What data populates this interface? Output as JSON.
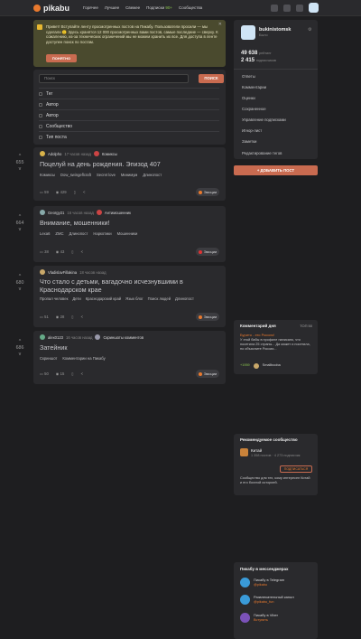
{
  "header": {
    "logo": "pikabu",
    "nav": [
      "Горячее",
      "Лучшее",
      "Свежее",
      "Подписки",
      "Сообщества"
    ],
    "subs_count": "90+"
  },
  "notice": {
    "text": "Привет! Вступайте ленту просмотренных постов на Пикабу. Пользователи просили — мы сделали 🙂 Здесь хранятся 12 000 просмотренных вами постов, самые последние — сверху. К сожалению, из-за технических ограничений мы не можем хранить их все. Для доступа в ленте доступен поиск по постам.",
    "button": "ПОНЯТНО"
  },
  "search": {
    "placeholder": "Поиск",
    "button": "ПОИСК",
    "filters": [
      "Тег",
      "Автор",
      "Автор",
      "Сообщество",
      "Тип поста"
    ]
  },
  "posts": [
    {
      "rating": "655",
      "author": "Adolpho",
      "time": "17 часов назад",
      "community": "Комиксы",
      "title": "Поцелуй на день рождения. Эпизод 407",
      "tags": [
        "Комиксы",
        "Dow_swingeflcraft",
        "Secret love",
        "Минимум",
        "Длинопост"
      ],
      "comments": "59",
      "views": "429",
      "emotion": "Эмоции"
    },
    {
      "rating": "664",
      "author": "Georgy21",
      "time": "16 часов назад",
      "community": "Антимошенник",
      "title": "Внимание, мошенники!",
      "tags": [
        "Lexa6",
        "ZMC",
        "Длинопост",
        "Наркотики",
        "Мошенники"
      ],
      "comments": "38",
      "views": "43",
      "emotion": "Эмоции"
    },
    {
      "rating": "680",
      "author": "VladislavFillakina",
      "time": "18 часов назад",
      "community": "",
      "title": "Что стало с детьми, вагадочно исчезнувшими в Краснодарском крае",
      "tags": [
        "Пропал человек",
        "Дети",
        "Краснодарский край",
        "Язык блог",
        "Поиск людей",
        "Длинопост"
      ],
      "comments": "51",
      "views": "28",
      "emotion": "Эмоции"
    },
    {
      "rating": "686",
      "author": "alex0123",
      "time": "16 часов назад",
      "community": "Скриншоты комментов",
      "title": "Затейник",
      "tags": [
        "Скриншот",
        "Комментарии на Пикабу"
      ],
      "comments": "50",
      "views": "15",
      "emotion": "Эмоции"
    }
  ],
  "profile": {
    "name": "bukinistomsk",
    "sub": "Было",
    "rating": "49 638",
    "rating_label": "рейтинг",
    "subscribers": "2 415",
    "subs_label": "подписчиков",
    "links": [
      "Ответы",
      "Комментарии",
      "Оценки",
      "Сохраненное",
      "Управление подписками",
      "Игнор-лист",
      "Заметки",
      "Редактирование тегов"
    ]
  },
  "add_post": "+ ДОБАВИТЬ ПОСТ",
  "comment_day": {
    "title": "Комментарий дня",
    "top": "ТОП 50",
    "user": "Бурито - это Россия!",
    "text": "У этой бабы в профиле написано, что посетила 25 страны... Да может и посетила, но объясните России...",
    "likes": "+1959",
    "reply_user": "Smallbooba"
  },
  "recommended": {
    "title": "Рекомендуемое сообщество",
    "name": "Китай",
    "stats": "1 358 постов · 4 273 подписчик",
    "button": "ПОДПИСАТЬСЯ",
    "text": "Сообщество для тех, кому интересен Китай и его богатой историей."
  },
  "messengers": {
    "title": "Пикабу в мессенджерах",
    "items": [
      {
        "name": "Пикабу в Telegram",
        "sub": "@pikabu",
        "color": "#3a9bd9"
      },
      {
        "name": "Развлекательный канал",
        "sub": "@pikabu_fun",
        "color": "#3a9bd9"
      },
      {
        "name": "Пикабу в Viber",
        "sub": "Вступить",
        "color": "#7b52b9"
      }
    ]
  }
}
